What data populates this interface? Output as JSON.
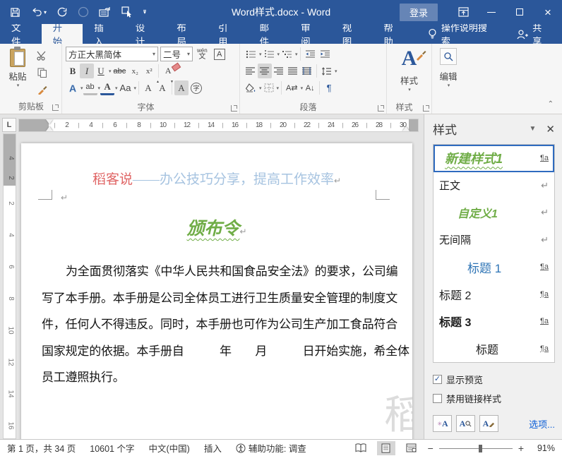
{
  "titlebar": {
    "title": "Word样式.docx - Word",
    "signin": "登录"
  },
  "tabs": {
    "items": [
      {
        "label": "文件",
        "cls": ""
      },
      {
        "label": "开始",
        "cls": "active"
      },
      {
        "label": "插入",
        "cls": ""
      },
      {
        "label": "设计",
        "cls": ""
      },
      {
        "label": "布局",
        "cls": ""
      },
      {
        "label": "引用",
        "cls": ""
      },
      {
        "label": "邮件",
        "cls": ""
      },
      {
        "label": "审阅",
        "cls": ""
      },
      {
        "label": "视图",
        "cls": ""
      },
      {
        "label": "帮助",
        "cls": ""
      }
    ],
    "tell_me": "操作说明搜索",
    "share": "共享"
  },
  "ribbon": {
    "clipboard": {
      "label": "剪贴板",
      "paste": "粘贴"
    },
    "font": {
      "label": "字体",
      "name": "方正大黑简体",
      "size": "二号",
      "bold": "B",
      "italic": "I",
      "underline": "U",
      "strike": "abc",
      "subscript": "x₂",
      "superscript": "x²",
      "change_case": "Aa",
      "phonetic_top": "wén",
      "phonetic_bottom": "文",
      "char_border": "A",
      "effects_a": "A",
      "highlight_ab": "ab",
      "color_a": "A",
      "grow_a": "A",
      "shrink_a": "A",
      "shading_a": "A",
      "enclose": "字",
      "clear_a": "A"
    },
    "paragraph": {
      "label": "段落",
      "sort": "A↓",
      "asian": "A⇄",
      "pilcrow": "¶"
    },
    "styles": {
      "label": "样式",
      "button": "样式",
      "big_a": "A"
    },
    "editing": {
      "label": "编辑"
    }
  },
  "ruler": {
    "corner": "L",
    "h_numbers": [
      2,
      4,
      6,
      8,
      10,
      12,
      14,
      16,
      18,
      20,
      22,
      24,
      26,
      28,
      30
    ],
    "v_margin_numbers": [
      4,
      2
    ],
    "v_numbers": [
      2,
      4,
      6,
      8,
      10,
      12,
      14,
      16
    ]
  },
  "document": {
    "header_red": "稻客说",
    "header_blue": "——办公技巧分享，提高工作效率",
    "pilcrow": "↵",
    "title": "颁布令",
    "body_lines": [
      {
        "text": "为全面贯彻落实《中华人民共和国食品安全法》的要求，公司编",
        "cls": "indent"
      },
      {
        "text": "写了本手册。本手册是公司全体员工进行卫生质量安全管理的制度文",
        "cls": ""
      },
      {
        "text": "件，任何人不得违反。同时，本手册也可作为公司生产加工食品符合",
        "cls": ""
      },
      {
        "text": "国家规定的依据。本手册自　　　年　　月　　　日开始实施，希全体",
        "cls": ""
      },
      {
        "text": "员工遵照执行。",
        "cls": "last"
      }
    ],
    "watermark": "稻"
  },
  "styles_pane": {
    "title": "样式",
    "items": [
      {
        "label": "新建样式1",
        "cls": "st-new sel",
        "mark": "¶a",
        "mcls": "m-pa"
      },
      {
        "label": "正文",
        "cls": "st-plain",
        "mark": "↵",
        "mcls": "m-ret"
      },
      {
        "label": "自定义1",
        "cls": "st-custom",
        "mark": "↵",
        "mcls": "m-ret"
      },
      {
        "label": "无间隔",
        "cls": "st-plain",
        "mark": "↵",
        "mcls": "m-ret"
      },
      {
        "label": "标题 1",
        "cls": "st-h1",
        "mark": "¶a",
        "mcls": "m-pa"
      },
      {
        "label": "标题 2",
        "cls": "st-h2",
        "mark": "¶a",
        "mcls": "m-pa"
      },
      {
        "label": "标题 3",
        "cls": "st-h3",
        "mark": "¶a",
        "mcls": "m-pa"
      },
      {
        "label": "标题",
        "cls": "st-heading",
        "mark": "¶a",
        "mcls": "m-pa"
      }
    ],
    "show_preview": "显示预览",
    "disable_linked": "禁用链接样式",
    "check_mark": "✓",
    "options": "选项..."
  },
  "statusbar": {
    "segments": [
      {
        "label": "第 1 页，共 34 页"
      },
      {
        "label": "10601 个字"
      },
      {
        "label": "中文(中国)"
      },
      {
        "label": "插入"
      }
    ],
    "accessibility": "辅助功能: 调查",
    "zoom_minus": "−",
    "zoom_plus": "+",
    "zoom": "91%"
  },
  "colors": {
    "titlebar_blue": "#2b579a",
    "style_green": "#70ad47",
    "heading_blue": "#2e74b5",
    "header_red": "#e06666",
    "header_pale_blue": "#a6c3e0",
    "options_link_blue": "#0b5ed7"
  }
}
